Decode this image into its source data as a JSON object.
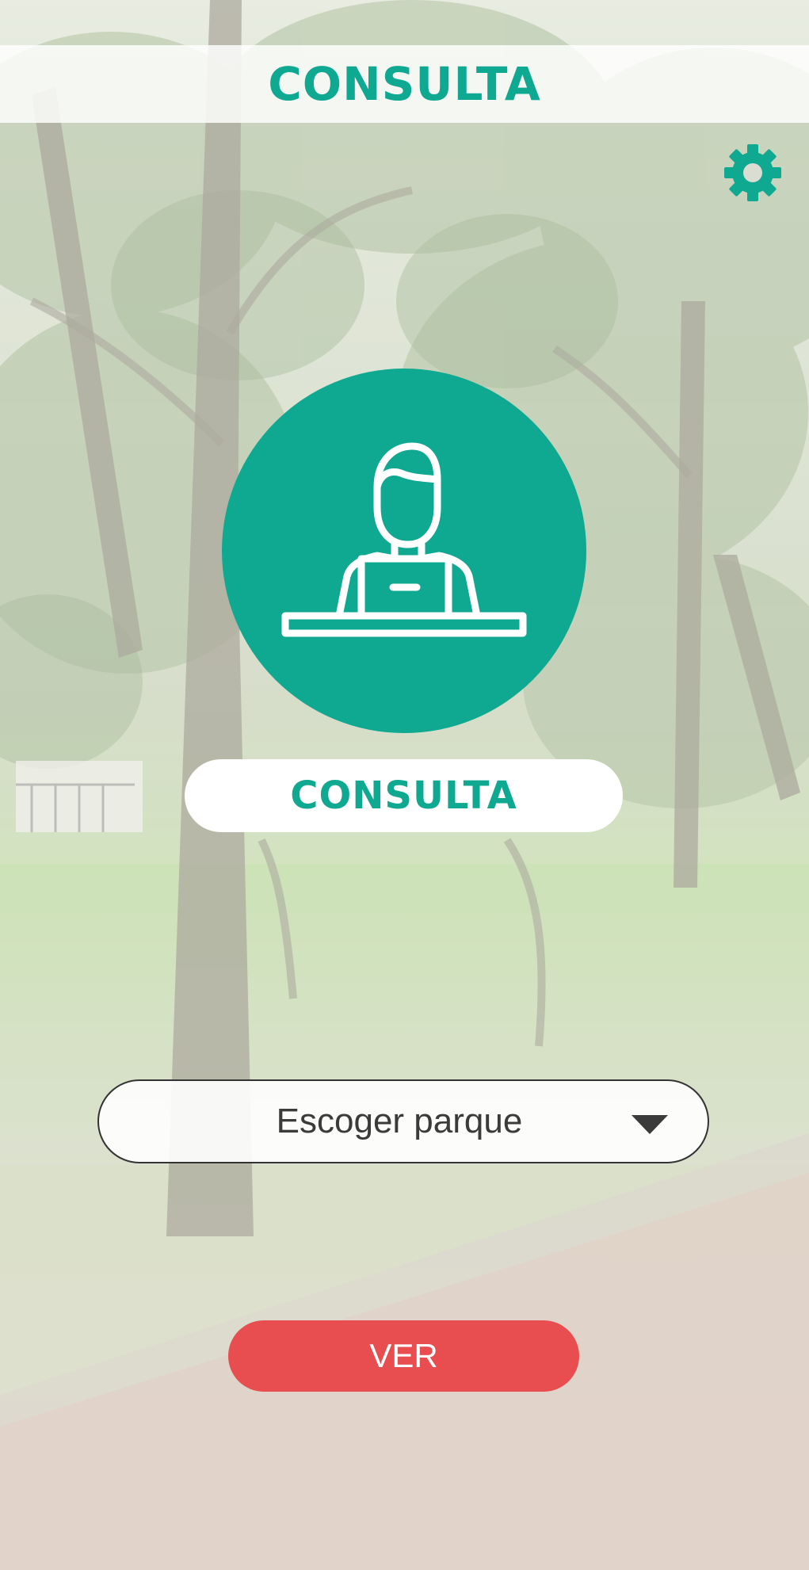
{
  "header": {
    "title": "CONSULTA",
    "settings_icon": "gear-icon"
  },
  "role": {
    "icon": "person-at-laptop-icon",
    "label": "CONSULTA"
  },
  "park_select": {
    "value": "Escoger parque",
    "icon": "triangle-down-icon"
  },
  "actions": {
    "view_label": "VER"
  },
  "colors": {
    "accent": "#0fa891",
    "button": "#e84d4f",
    "text_dark": "#3b3b3b"
  }
}
